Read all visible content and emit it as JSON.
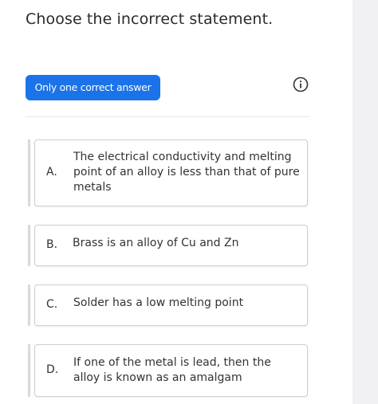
{
  "question": {
    "title": "Choose the incorrect statement."
  },
  "answer_type": {
    "label": "Only one correct answer",
    "color": "#1a73e8"
  },
  "info": {
    "icon": "info-circle-icon"
  },
  "options": [
    {
      "letter": "A.",
      "text": "The electrical conductivity and melting point of an alloy is less than that of pure metals"
    },
    {
      "letter": "B.",
      "text": "Brass is an alloy of Cu and Zn"
    },
    {
      "letter": "C.",
      "text": "Solder has a low melting point"
    },
    {
      "letter": "D.",
      "text": "If one of the metal is lead, then the alloy is known as an amalgam"
    }
  ]
}
